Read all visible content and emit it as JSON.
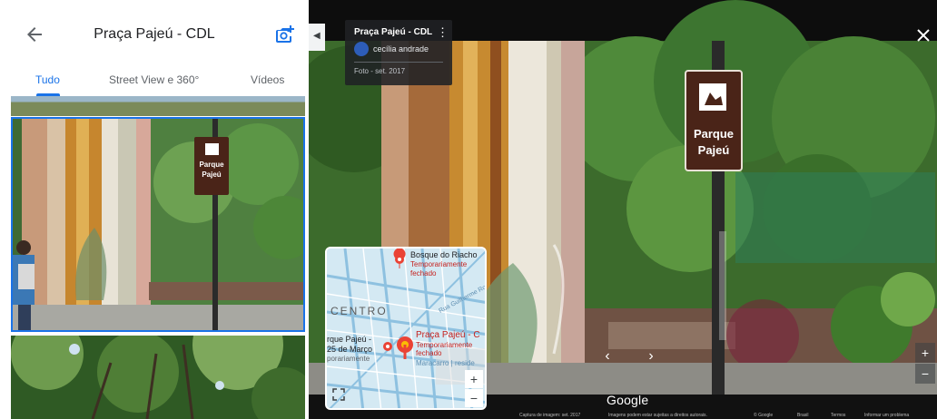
{
  "header": {
    "title": "Praça Pajeú - CDL",
    "back_icon": "arrow-back-icon",
    "camera_icon": "add-photo-camera-icon"
  },
  "tabs": [
    {
      "label": "Tudo",
      "active": true
    },
    {
      "label": "Street View e 360°",
      "active": false
    },
    {
      "label": "Vídeos",
      "active": false
    }
  ],
  "photo_card": {
    "title": "Praça Pajeú - CDL",
    "avatar_text": "",
    "author": "cecília andrade",
    "date": "Foto - set. 2017"
  },
  "sign": {
    "line1": "Parque",
    "line2": "Pajeú"
  },
  "minimap": {
    "place1_name": "Bosque do Riacho",
    "place1_status": "Temporariamente fechado",
    "centro_label": "CENTRO",
    "street_label": "Rua Guilherme Rocha",
    "place2_name": "Praça Pajeú - C",
    "place2_status1": "Temporariamente",
    "place2_status2": "fechado",
    "place3_line1": "rque Pajeú -",
    "place3_line2": "25 de Março",
    "place3_status": "porariamente",
    "place4": "Maracarro | reside"
  },
  "viewer": {
    "google_label": "Google",
    "footer": [
      "Captura de imagem: set. 2017",
      "Imagens podem estar sujeitas a direitos autorais.",
      "© Google",
      "Brasil",
      "Termos",
      "Informar um problema"
    ]
  },
  "colors": {
    "accent": "#1a73e8",
    "pin_red": "#ea4335",
    "sign_brown": "#4a2418"
  }
}
